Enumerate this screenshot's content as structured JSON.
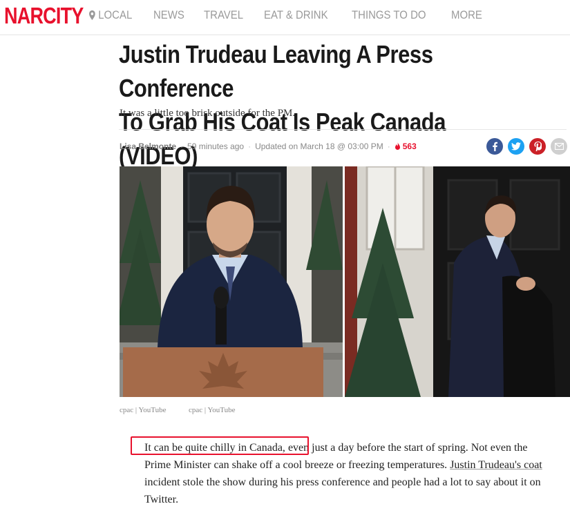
{
  "site": {
    "logo": "NARCITY",
    "nav": [
      "LOCAL",
      "NEWS",
      "TRAVEL",
      "EAT & DRINK",
      "THINGS TO DO",
      "MORE"
    ]
  },
  "article": {
    "headline_line1": "Justin Trudeau Leaving A Press Conference",
    "headline_line2": "To Grab His Coat Is Peak Canada (VIDEO)",
    "subtitle": "It was a little too brisk outside for the PM.",
    "author": "Lisa Belmonte",
    "time_ago": "59 minutes ago",
    "updated": "Updated on March 18 @ 03:00 PM",
    "hot_count": "563",
    "image_credits": [
      "cpac | YouTube",
      "cpac | YouTube"
    ],
    "body": {
      "highlighted": "It can be quite chilly in Canada,",
      "part1": " even just a day before the start of spring. Not even the Prime Minister can shake off a cool breeze or freezing temperatures. ",
      "link": "Justin Trudeau's coat",
      "part2": " incident stole the show during his press conference and people had a lot to say about it on Twitter."
    }
  },
  "share_icons": [
    "facebook-icon",
    "twitter-icon",
    "pinterest-icon",
    "email-icon"
  ],
  "colors": {
    "brand_red": "#e8112d",
    "facebook": "#3b5998",
    "twitter": "#1da1f2",
    "pinterest": "#cb2027",
    "email": "#cfcfcf"
  }
}
